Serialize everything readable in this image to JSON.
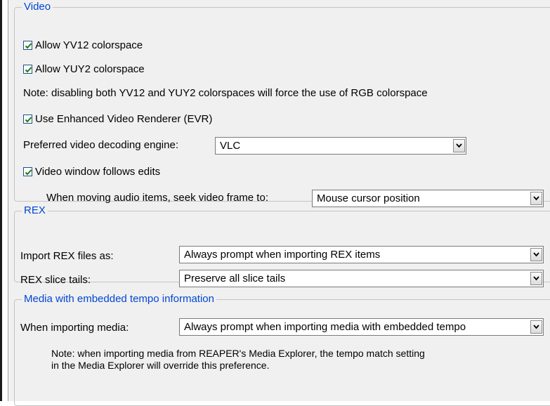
{
  "video": {
    "title": "Video",
    "allow_yv12": {
      "label": "Allow YV12 colorspace",
      "checked": true
    },
    "allow_yuy2": {
      "label": "Allow YUY2 colorspace",
      "checked": true
    },
    "note": "Note: disabling both YV12 and YUY2 colorspaces will force the use of RGB colorspace",
    "use_evr": {
      "label": "Use Enhanced Video Renderer (EVR)",
      "checked": true
    },
    "decoding_engine": {
      "label": "Preferred video decoding engine:",
      "value": "VLC"
    },
    "follows_edits": {
      "label": "Video window follows edits",
      "checked": true
    },
    "seek": {
      "label": "When moving audio items, seek video frame to:",
      "value": "Mouse cursor position"
    }
  },
  "rex": {
    "title": "REX",
    "import_as": {
      "label": "Import REX files as:",
      "value": "Always prompt when importing REX items"
    },
    "slice_tails": {
      "label": "REX slice tails:",
      "value": "Preserve all slice tails"
    }
  },
  "tempo": {
    "title": "Media with embedded tempo information",
    "when_importing": {
      "label": "When importing media:",
      "value": "Always prompt when importing media with embedded tempo"
    },
    "note_line1": "Note: when importing media from REAPER's Media Explorer, the tempo match setting",
    "note_line2": "in the Media Explorer will override this preference."
  },
  "colors": {
    "legend": "#0046d5",
    "panel": "#f0f0f0",
    "checkmark": "#1a7a1a"
  }
}
